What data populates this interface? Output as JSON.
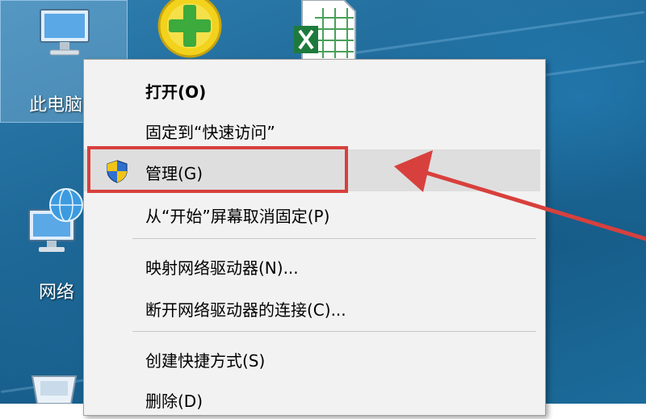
{
  "desktop": {
    "icons": [
      {
        "label": "此电脑"
      },
      {
        "label": "网络"
      }
    ]
  },
  "context_menu": {
    "items": [
      {
        "label": "打开(O)"
      },
      {
        "label": "固定到“快速访问”"
      },
      {
        "label": "管理(G)"
      },
      {
        "label": "从“开始”屏幕取消固定(P)"
      },
      {
        "label": "映射网络驱动器(N)..."
      },
      {
        "label": "断开网络驱动器的连接(C)..."
      },
      {
        "label": "创建快捷方式(S)"
      },
      {
        "label": "删除(D)"
      }
    ]
  },
  "colors": {
    "annotation_red": "#d8403d",
    "menu_bg": "#f2f2f2",
    "highlight_bg": "#dedede"
  }
}
